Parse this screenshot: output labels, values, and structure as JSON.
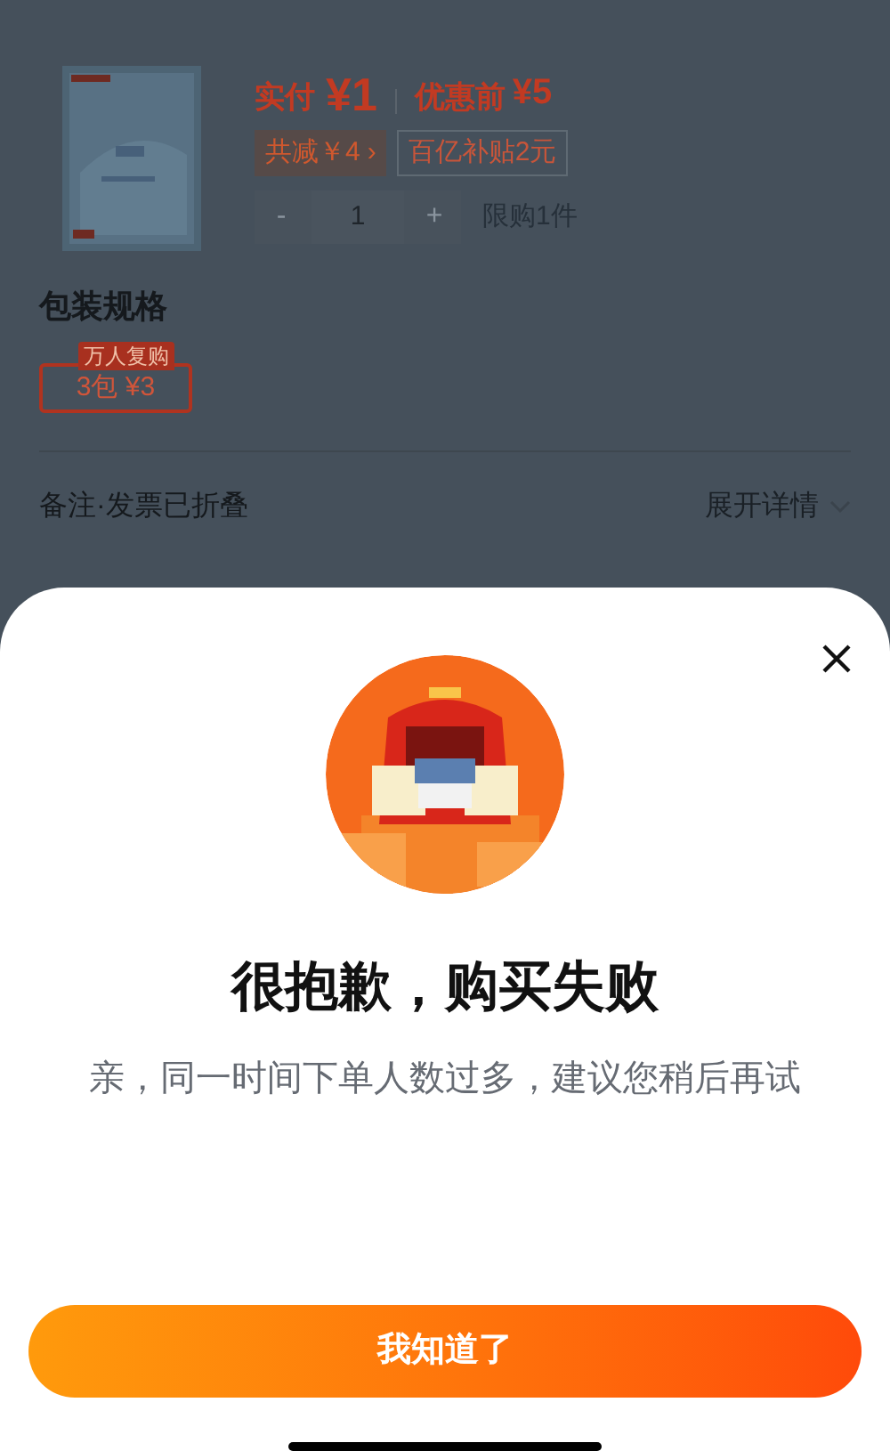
{
  "order": {
    "price_label": "实付",
    "price": "¥1",
    "original_label": "优惠前",
    "original_price": "¥5",
    "discount": "共减￥4",
    "discount_caret": "›",
    "subsidy": "百亿补贴2元",
    "stepper": {
      "minus": "-",
      "value": "1",
      "plus": "+"
    },
    "limit": "限购1件",
    "spec_title": "包装规格",
    "specs": [
      {
        "label": "3包  ¥3",
        "badge": "万人复购",
        "selected": true
      }
    ],
    "notes_label": "备注·发票已折叠",
    "expand": "展开详情"
  },
  "dialog": {
    "title": "很抱歉，购买失败",
    "message": "亲，同一时间下单人数过多，建议您稍后再试",
    "button": "我知道了"
  }
}
